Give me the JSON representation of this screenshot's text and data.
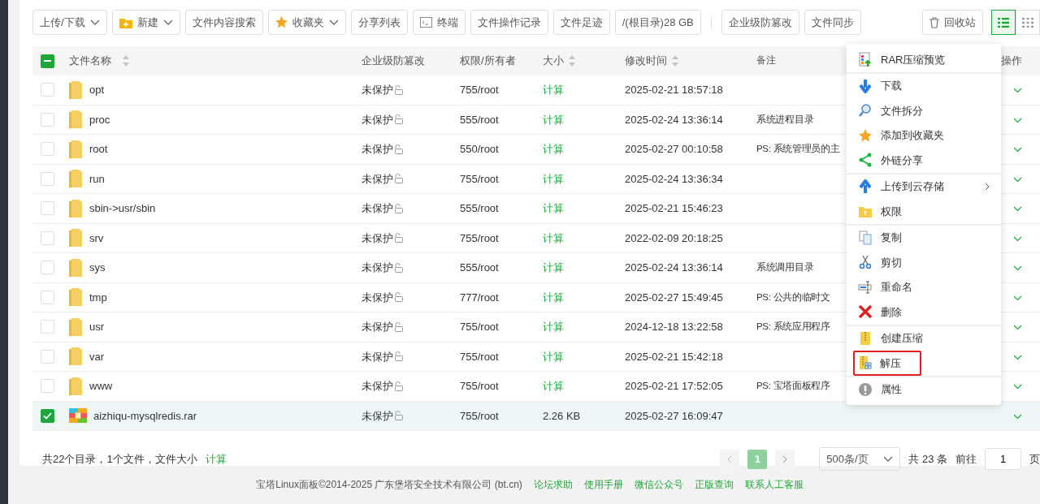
{
  "toolbar": [
    {
      "label": "上传/下载",
      "kind": "plain",
      "dropdown": true
    },
    {
      "label": "新建",
      "kind": "folder",
      "dropdown": true
    },
    {
      "label": "文件内容搜索",
      "kind": "plain",
      "dropdown": false
    },
    {
      "label": "收藏夹",
      "kind": "star",
      "dropdown": true
    },
    {
      "label": "分享列表",
      "kind": "plain",
      "dropdown": false
    },
    {
      "label": "终端",
      "kind": "terminal",
      "dropdown": false
    },
    {
      "label": "文件操作记录",
      "kind": "plain",
      "dropdown": false
    },
    {
      "label": "文件足迹",
      "kind": "plain",
      "dropdown": false
    },
    {
      "label": "/(根目录)28 GB",
      "kind": "plain",
      "dropdown": false
    },
    {
      "label": "企业级防篡改",
      "kind": "plain",
      "dropdown": false,
      "divider_before": true
    },
    {
      "label": "文件同步",
      "kind": "plain",
      "dropdown": false
    }
  ],
  "recycle_button": {
    "label": "回收站"
  },
  "view_modes": [
    {
      "kind": "list",
      "selected": true
    },
    {
      "kind": "grid",
      "selected": false
    }
  ],
  "table": {
    "select_all": {
      "indeterminate": true
    },
    "columns": [
      {
        "label": "文件名称",
        "sortable": true
      },
      {
        "label": "企业级防篡改",
        "sortable": false
      },
      {
        "label": "权限/所有者",
        "sortable": false
      },
      {
        "label": "大小",
        "sortable": true
      },
      {
        "label": "修改时间",
        "sortable": true
      },
      {
        "label": "备注",
        "sortable": false
      },
      {
        "label": "操作",
        "sortable": false
      }
    ],
    "rows": [
      {
        "kind": "folder",
        "name": "opt",
        "protection": "未保护",
        "permission": "755/root",
        "size": "计算",
        "size_link": true,
        "modified": "2025-02-21 18:57:18",
        "note": "",
        "checked": false
      },
      {
        "kind": "folder",
        "name": "proc",
        "protection": "未保护",
        "permission": "555/root",
        "size": "计算",
        "size_link": true,
        "modified": "2025-02-24 13:36:14",
        "note": "系统进程目录",
        "checked": false
      },
      {
        "kind": "folder",
        "name": "root",
        "protection": "未保护",
        "permission": "550/root",
        "size": "计算",
        "size_link": true,
        "modified": "2025-02-27 00:10:58",
        "note": "PS: 系统管理员的主",
        "checked": false
      },
      {
        "kind": "folder",
        "name": "run",
        "protection": "未保护",
        "permission": "755/root",
        "size": "计算",
        "size_link": true,
        "modified": "2025-02-24 13:36:34",
        "note": "",
        "checked": false
      },
      {
        "kind": "folder",
        "name": "sbin->usr/sbin",
        "protection": "未保护",
        "permission": "555/root",
        "size": "计算",
        "size_link": true,
        "modified": "2025-02-21 15:46:23",
        "note": "",
        "checked": false
      },
      {
        "kind": "folder",
        "name": "srv",
        "protection": "未保护",
        "permission": "755/root",
        "size": "计算",
        "size_link": true,
        "modified": "2022-02-09 20:18:25",
        "note": "",
        "checked": false
      },
      {
        "kind": "folder",
        "name": "sys",
        "protection": "未保护",
        "permission": "555/root",
        "size": "计算",
        "size_link": true,
        "modified": "2025-02-24 13:36:14",
        "note": "系统调用目录",
        "checked": false
      },
      {
        "kind": "folder",
        "name": "tmp",
        "protection": "未保护",
        "permission": "777/root",
        "size": "计算",
        "size_link": true,
        "modified": "2025-02-27 15:49:45",
        "note": "PS: 公共的临时文",
        "checked": false
      },
      {
        "kind": "folder",
        "name": "usr",
        "protection": "未保护",
        "permission": "755/root",
        "size": "计算",
        "size_link": true,
        "modified": "2024-12-18 13:22:58",
        "note": "PS: 系统应用程序",
        "checked": false
      },
      {
        "kind": "folder",
        "name": "var",
        "protection": "未保护",
        "permission": "755/root",
        "size": "计算",
        "size_link": true,
        "modified": "2025-02-21 15:42:18",
        "note": "",
        "checked": false
      },
      {
        "kind": "folder",
        "name": "www",
        "protection": "未保护",
        "permission": "755/root",
        "size": "计算",
        "size_link": true,
        "modified": "2025-02-21 17:52:05",
        "note": "PS: 宝塔面板程序",
        "checked": false
      },
      {
        "kind": "archive",
        "name": "aizhiqu-mysqlredis.rar",
        "protection": "未保护",
        "permission": "755/root",
        "size": "2.26 KB",
        "size_link": false,
        "modified": "2025-02-27 16:09:47",
        "note": "",
        "checked": true
      }
    ]
  },
  "summary": {
    "text": "共22个目录，1个文件，文件大小",
    "link": "计算"
  },
  "pagination": {
    "pages": [
      {
        "label": "1",
        "selected": true
      }
    ],
    "page_size": "500条/页",
    "total": "共 23 条",
    "goto_label": "前往",
    "goto_value": "1",
    "page_unit": "页"
  },
  "context_menu": {
    "groups": [
      [
        {
          "kind": "rar",
          "label": "RAR压缩预览",
          "submenu": false,
          "highlighted": false
        }
      ],
      [
        {
          "kind": "download",
          "label": "下载",
          "submenu": false,
          "highlighted": false
        },
        {
          "kind": "magnifier",
          "label": "文件拆分",
          "submenu": false,
          "highlighted": false
        },
        {
          "kind": "star",
          "label": "添加到收藏夹",
          "submenu": false,
          "highlighted": false
        },
        {
          "kind": "share",
          "label": "外链分享",
          "submenu": false,
          "highlighted": false
        }
      ],
      [
        {
          "kind": "upload",
          "label": "上传到云存储",
          "submenu": true,
          "highlighted": false
        },
        {
          "kind": "permission",
          "label": "权限",
          "submenu": false,
          "highlighted": false
        }
      ],
      [
        {
          "kind": "copy",
          "label": "复制",
          "submenu": false,
          "highlighted": false
        },
        {
          "kind": "cut",
          "label": "剪切",
          "submenu": false,
          "highlighted": false
        },
        {
          "kind": "rename",
          "label": "重命名",
          "submenu": false,
          "highlighted": false
        },
        {
          "kind": "delete",
          "label": "删除",
          "submenu": false,
          "highlighted": false
        }
      ],
      [
        {
          "kind": "zip",
          "label": "创建压缩",
          "submenu": false,
          "highlighted": false
        },
        {
          "kind": "unzip",
          "label": "解压",
          "submenu": false,
          "highlighted": true
        }
      ],
      [
        {
          "kind": "info",
          "label": "属性",
          "submenu": false,
          "highlighted": false
        }
      ]
    ]
  },
  "footer": {
    "copyright": "宝塔Linux面板©2014-2025 广东堡塔安全技术有限公司 (bt.cn)",
    "links": [
      "论坛求助",
      "使用手册",
      "微信公众号",
      "正版查询",
      "联系人工客服"
    ]
  }
}
